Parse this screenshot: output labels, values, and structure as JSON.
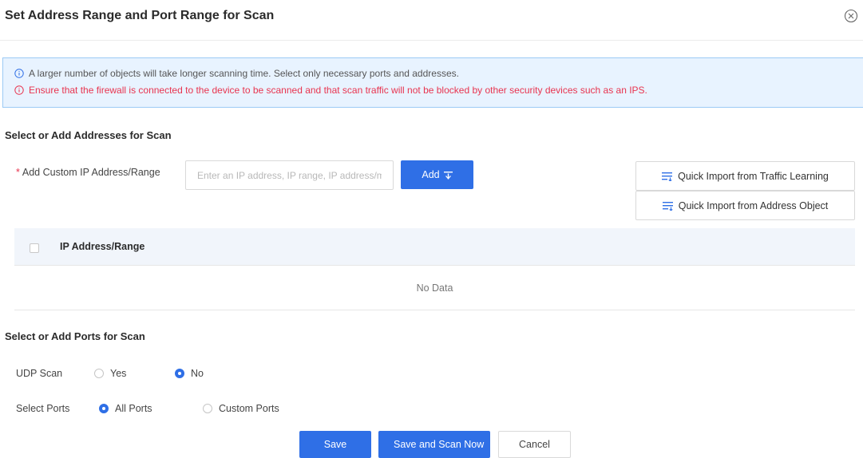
{
  "dialog": {
    "title": "Set Address Range and Port Range for Scan",
    "close_icon": "close-circle-icon"
  },
  "notice": {
    "info_icon": "info-circle-icon",
    "line1": "A larger number of objects will take longer scanning time. Select only necessary ports and addresses.",
    "line2": "Ensure that the firewall is connected to the device to be scanned and that scan traffic will not be blocked by other security devices such as an IPS."
  },
  "addresses": {
    "section_title": "Select or Add Addresses for Scan",
    "required_mark": "*",
    "field_label": "Add Custom IP Address/Range",
    "input_value": "",
    "input_placeholder": "Enter an IP address, IP range, IP address/mask",
    "add_button": "Add",
    "add_icon": "add-import-icon",
    "import_traffic_button": "Quick Import from Traffic Learning",
    "import_address_button": "Quick Import from Address Object",
    "import_icon": "list-import-icon",
    "table": {
      "column_header": "IP Address/Range",
      "rows": [],
      "empty_text": "No Data"
    }
  },
  "ports": {
    "section_title": "Select or Add Ports for Scan",
    "udp_scan": {
      "label": "UDP Scan",
      "options": [
        "Yes",
        "No"
      ],
      "selected": "No"
    },
    "select_ports": {
      "label": "Select Ports",
      "options": [
        "All Ports",
        "Custom Ports"
      ],
      "selected": "All Ports"
    }
  },
  "footer": {
    "save": "Save",
    "save_and_scan": "Save and Scan Now",
    "cancel": "Cancel"
  },
  "colors": {
    "primary": "#2f6fe6",
    "warning_text": "#e8344f",
    "notice_bg": "#e8f3ff",
    "notice_border": "#9ccaf5"
  }
}
